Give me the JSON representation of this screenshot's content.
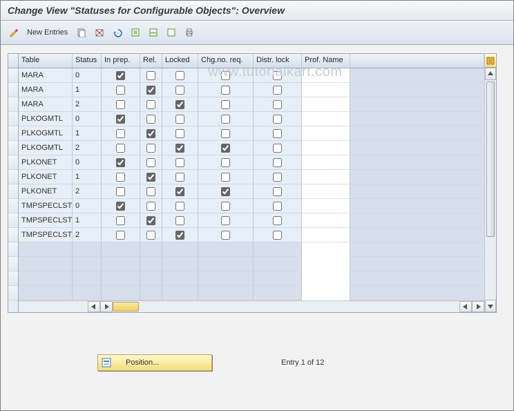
{
  "title": "Change View \"Statuses for Configurable Objects\": Overview",
  "watermark": "www.tutorialkart.com",
  "toolbar": {
    "new_entries": "New Entries"
  },
  "columns": {
    "table": "Table",
    "status": "Status",
    "inprep": "In prep.",
    "rel": "Rel.",
    "locked": "Locked",
    "chgreq": "Chg.no. req.",
    "distr": "Distr. lock",
    "prof": "Prof. Name"
  },
  "rows": [
    {
      "table": "MARA",
      "status": "0",
      "inprep": true,
      "rel": false,
      "locked": false,
      "chgreq": false,
      "distr": false,
      "prof": ""
    },
    {
      "table": "MARA",
      "status": "1",
      "inprep": false,
      "rel": true,
      "locked": false,
      "chgreq": false,
      "distr": false,
      "prof": ""
    },
    {
      "table": "MARA",
      "status": "2",
      "inprep": false,
      "rel": false,
      "locked": true,
      "chgreq": false,
      "distr": false,
      "prof": ""
    },
    {
      "table": "PLKOGMTL",
      "status": "0",
      "inprep": true,
      "rel": false,
      "locked": false,
      "chgreq": false,
      "distr": false,
      "prof": ""
    },
    {
      "table": "PLKOGMTL",
      "status": "1",
      "inprep": false,
      "rel": true,
      "locked": false,
      "chgreq": false,
      "distr": false,
      "prof": ""
    },
    {
      "table": "PLKOGMTL",
      "status": "2",
      "inprep": false,
      "rel": false,
      "locked": true,
      "chgreq": true,
      "distr": false,
      "prof": ""
    },
    {
      "table": "PLKONET",
      "status": "0",
      "inprep": true,
      "rel": false,
      "locked": false,
      "chgreq": false,
      "distr": false,
      "prof": ""
    },
    {
      "table": "PLKONET",
      "status": "1",
      "inprep": false,
      "rel": true,
      "locked": false,
      "chgreq": false,
      "distr": false,
      "prof": ""
    },
    {
      "table": "PLKONET",
      "status": "2",
      "inprep": false,
      "rel": false,
      "locked": true,
      "chgreq": true,
      "distr": false,
      "prof": ""
    },
    {
      "table": "TMPSPECLST",
      "status": "0",
      "inprep": true,
      "rel": false,
      "locked": false,
      "chgreq": false,
      "distr": false,
      "prof": ""
    },
    {
      "table": "TMPSPECLST",
      "status": "1",
      "inprep": false,
      "rel": true,
      "locked": false,
      "chgreq": false,
      "distr": false,
      "prof": ""
    },
    {
      "table": "TMPSPECLST",
      "status": "2",
      "inprep": false,
      "rel": false,
      "locked": true,
      "chgreq": false,
      "distr": false,
      "prof": ""
    }
  ],
  "empty_rows": 4,
  "footer": {
    "position_label": "Position...",
    "entry_text": "Entry 1 of 12"
  }
}
